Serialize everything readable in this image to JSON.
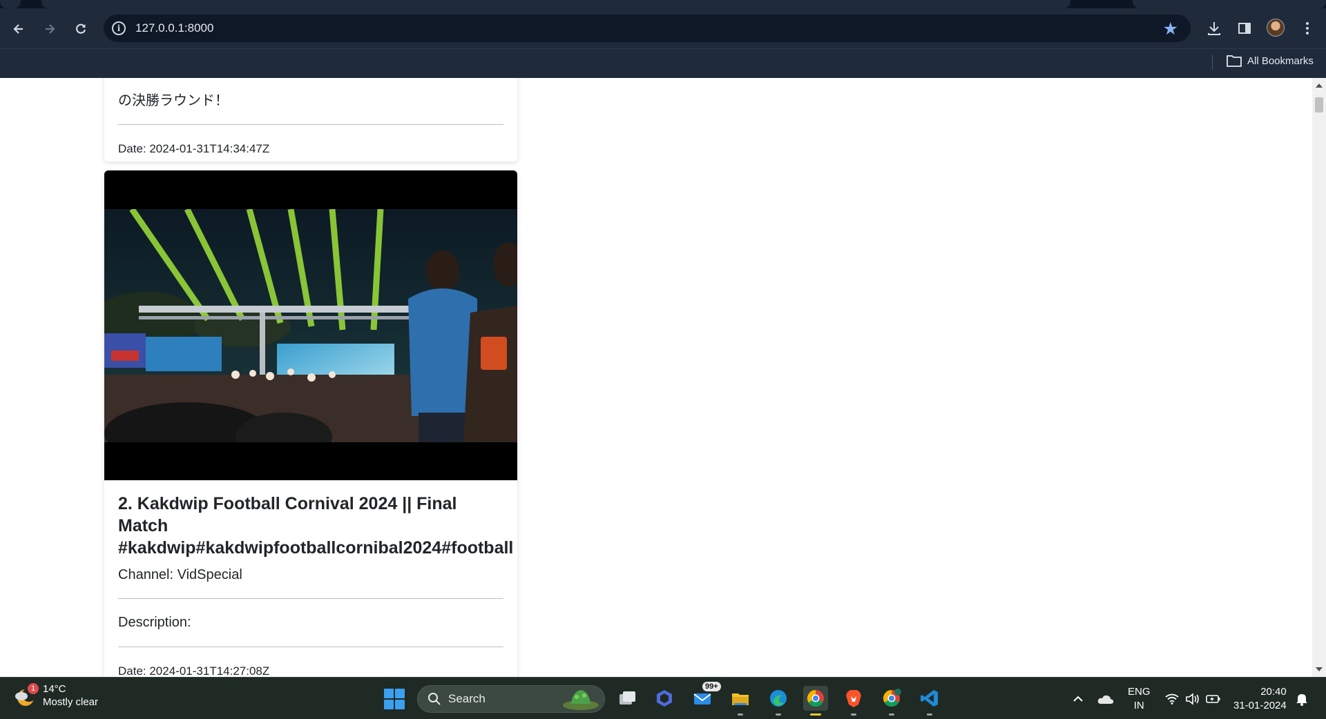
{
  "browser": {
    "url": "127.0.0.1:8000",
    "bookmarks_label": "All Bookmarks"
  },
  "page": {
    "card1": {
      "description_tail": "の決勝ラウンド！",
      "date": "Date: 2024-01-31T14:34:47Z"
    },
    "card2": {
      "title_line1": "2. Kakdwip Football Cornival 2024 || Final Match",
      "title_line2": "#kakdwip#kakdwipfootballcornibal2024#football",
      "channel": "Channel: VidSpecial",
      "description_label": "Description:",
      "date": "Date: 2024-01-31T14:27:08Z"
    }
  },
  "taskbar": {
    "weather_badge": "1",
    "temperature": "14°C",
    "condition": "Mostly clear",
    "search_label": "Search",
    "mail_badge": "99+",
    "lang_line1": "ENG",
    "lang_line2": "IN",
    "time": "20:40",
    "date": "31-01-2024"
  }
}
